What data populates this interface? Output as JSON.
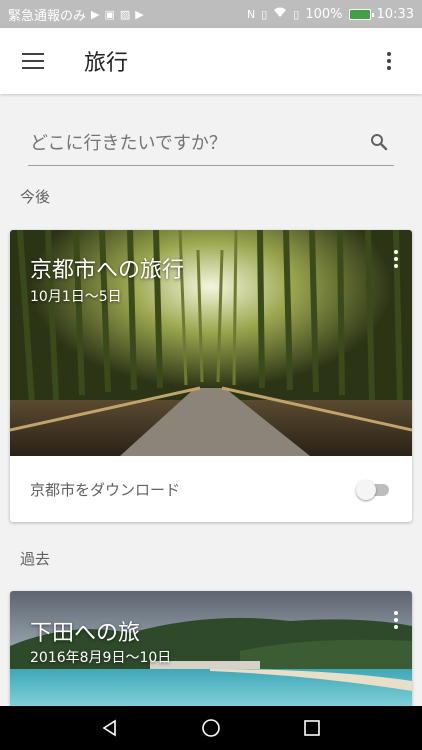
{
  "status_bar": {
    "notification_text": "緊急通報のみ",
    "battery_percent": "100%",
    "time": "10:33"
  },
  "app_bar": {
    "title": "旅行"
  },
  "search": {
    "placeholder": "どこに行きたいですか？"
  },
  "sections": {
    "upcoming_label": "今後",
    "past_label": "過去"
  },
  "upcoming_trip": {
    "title": "京都市への旅行",
    "dates": "10月1日〜5日",
    "download_label": "京都市をダウンロード",
    "download_enabled": false
  },
  "past_trip": {
    "title": "下田への旅",
    "dates": "2016年8月9日〜10日"
  },
  "colors": {
    "status_bar_bg": "#bdbdbd",
    "app_bar_bg": "#ffffff",
    "page_bg": "#f2f2f2",
    "battery": "#43a047"
  }
}
